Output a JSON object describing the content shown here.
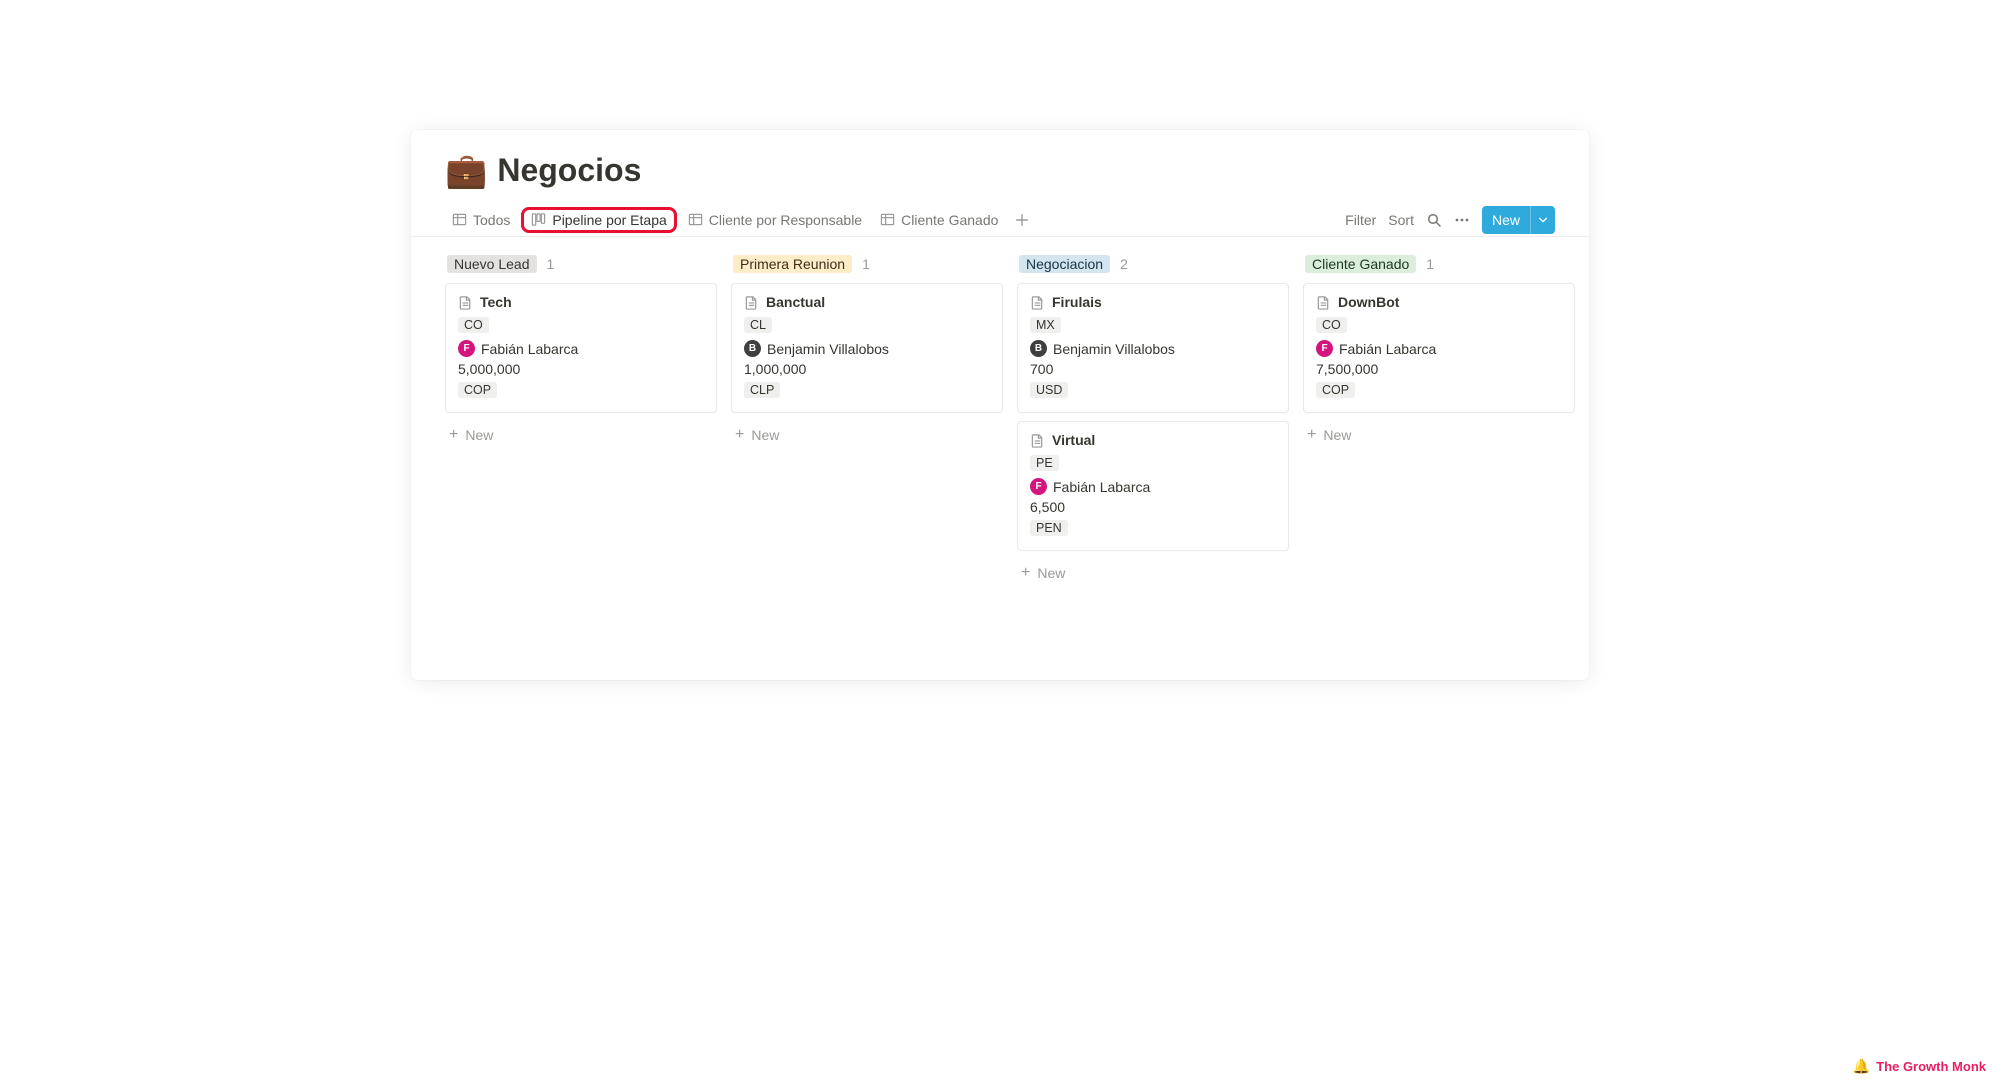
{
  "header": {
    "emoji": "💼",
    "title": "Negocios"
  },
  "tabs": {
    "items": [
      {
        "label": "Todos",
        "icon": "table"
      },
      {
        "label": "Pipeline por Etapa",
        "icon": "board",
        "highlighted": true
      },
      {
        "label": "Cliente por Responsable",
        "icon": "table"
      },
      {
        "label": "Cliente Ganado",
        "icon": "table"
      }
    ]
  },
  "toolbar": {
    "filter": "Filter",
    "sort": "Sort",
    "new_label": "New"
  },
  "columns": [
    {
      "stage": "Nuevo Lead",
      "chip": "grey",
      "count": "1",
      "cards": [
        {
          "title": "Tech",
          "country": "CO",
          "person": "Fabián Labarca",
          "avatar": "F",
          "avatar_color": "pink",
          "amount": "5,000,000",
          "currency": "COP"
        }
      ]
    },
    {
      "stage": "Primera Reunion",
      "chip": "yellow",
      "count": "1",
      "cards": [
        {
          "title": "Banctual",
          "country": "CL",
          "person": "Benjamin Villalobos",
          "avatar": "B",
          "avatar_color": "dark",
          "amount": "1,000,000",
          "currency": "CLP"
        }
      ]
    },
    {
      "stage": "Negociacion",
      "chip": "blue",
      "count": "2",
      "cards": [
        {
          "title": "Firulais",
          "country": "MX",
          "person": "Benjamin Villalobos",
          "avatar": "B",
          "avatar_color": "dark",
          "amount": "700",
          "currency": "USD"
        },
        {
          "title": "Virtual",
          "country": "PE",
          "person": "Fabián Labarca",
          "avatar": "F",
          "avatar_color": "pink",
          "amount": "6,500",
          "currency": "PEN"
        }
      ]
    },
    {
      "stage": "Cliente Ganado",
      "chip": "green",
      "count": "1",
      "cards": [
        {
          "title": "DownBot",
          "country": "CO",
          "person": "Fabián Labarca",
          "avatar": "F",
          "avatar_color": "pink",
          "amount": "7,500,000",
          "currency": "COP"
        }
      ]
    }
  ],
  "new_row_label": "New",
  "watermark": "The Growth Monk"
}
